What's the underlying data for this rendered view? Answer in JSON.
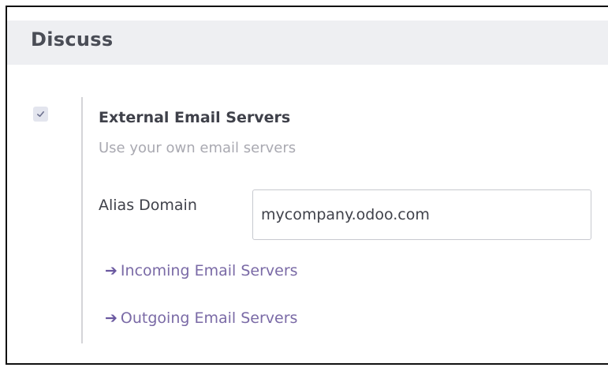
{
  "section": {
    "title": "Discuss"
  },
  "setting": {
    "checked": true,
    "title": "External Email Servers",
    "subtitle": "Use your own email servers"
  },
  "alias_field": {
    "label": "Alias Domain",
    "value": "mycompany.odoo.com"
  },
  "links": {
    "arrow_icon": "arrow-right-icon",
    "incoming": "Incoming Email Servers",
    "outgoing": "Outgoing Email Servers"
  },
  "colors": {
    "link": "#7a6aa6",
    "header_bg": "#eeeff2",
    "checkbox_bg": "#e3e5ee",
    "check": "#6f7390"
  }
}
